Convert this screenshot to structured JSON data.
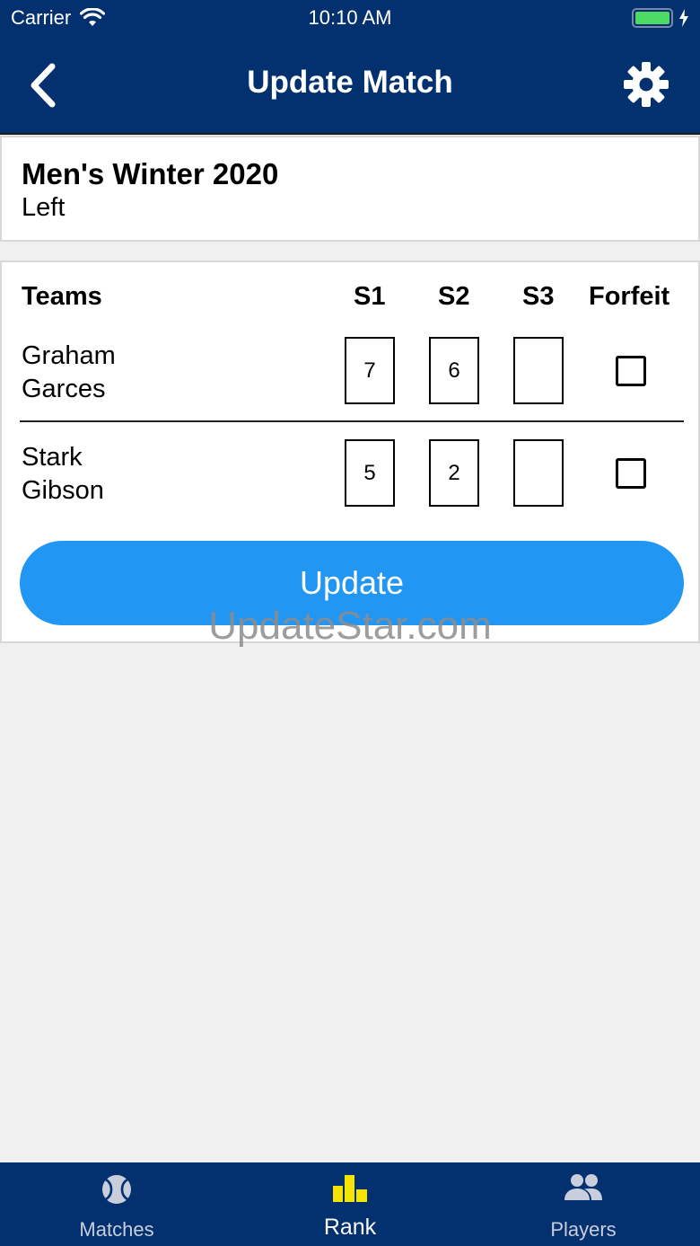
{
  "status_bar": {
    "carrier": "Carrier",
    "time": "10:10 AM"
  },
  "nav": {
    "title": "Update Match",
    "back_icon": "chevron-left-icon",
    "settings_icon": "gear-icon"
  },
  "league": {
    "name": "Men's Winter 2020",
    "side": "Left"
  },
  "table": {
    "headers": {
      "teams": "Teams",
      "s1": "S1",
      "s2": "S2",
      "s3": "S3",
      "forfeit": "Forfeit"
    },
    "rows": [
      {
        "players": [
          "Graham",
          "Garces"
        ],
        "s1": "7",
        "s2": "6",
        "s3": "",
        "forfeit": false
      },
      {
        "players": [
          "Stark",
          "Gibson"
        ],
        "s1": "5",
        "s2": "2",
        "s3": "",
        "forfeit": false
      }
    ]
  },
  "update_button": {
    "label": "Update",
    "color": "#2196f3"
  },
  "watermark": "UpdateStar.com",
  "tabs": [
    {
      "label": "Matches",
      "icon": "tennis-ball-icon",
      "active": false
    },
    {
      "label": "Rank",
      "icon": "podium-icon",
      "active": true,
      "icon_color": "#f5e400"
    },
    {
      "label": "Players",
      "icon": "people-icon",
      "active": false
    }
  ],
  "colors": {
    "brand": "#03306e",
    "accent": "#2196f3",
    "active_tab": "#f5e400"
  }
}
